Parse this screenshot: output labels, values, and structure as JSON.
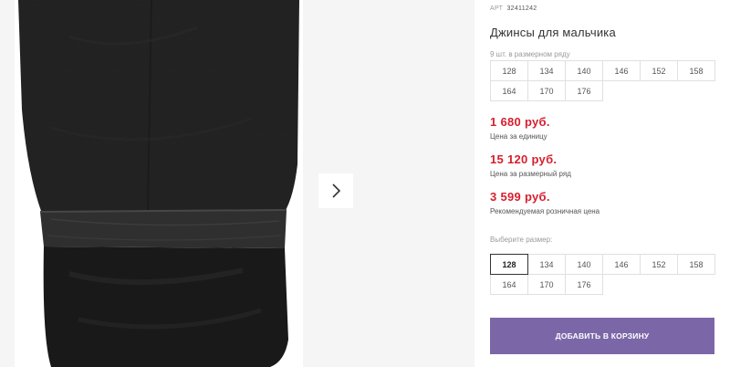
{
  "product": {
    "art_label": "АРТ",
    "art_number": "32411242",
    "title": "Джинсы для мальчика"
  },
  "size_row": {
    "label": "9 шт. в размерном ряду",
    "sizes": [
      "128",
      "134",
      "140",
      "146",
      "152",
      "158",
      "164",
      "170",
      "176"
    ]
  },
  "prices": [
    {
      "value": "1 680 руб.",
      "note": "Цена за единицу"
    },
    {
      "value": "15 120 руб.",
      "note": "Цена за размерный ряд"
    },
    {
      "value": "3 599 руб.",
      "note": "Рекомендуемая розничная цена"
    }
  ],
  "size_picker": {
    "label": "Выберите размер:",
    "sizes": [
      "128",
      "134",
      "140",
      "146",
      "152",
      "158",
      "164",
      "170",
      "176"
    ],
    "selected": "128"
  },
  "cart": {
    "add_label": "ДОБАВИТЬ В КОРЗИНУ"
  },
  "colors": {
    "price": "#d6202f",
    "button": "#7b67a8",
    "gallery_bg": "#f5f5f5"
  },
  "icons": {
    "next": "chevron-right-icon"
  }
}
